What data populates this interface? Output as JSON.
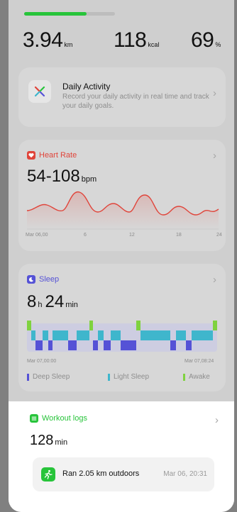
{
  "summary": {
    "distance": {
      "value": "3.94",
      "unit": "km"
    },
    "calories": {
      "value": "118",
      "unit": "kcal"
    },
    "goal": {
      "value": "69",
      "unit": "%"
    },
    "progress": 0.69
  },
  "daily_activity": {
    "title": "Daily Activity",
    "description": "Record your daily activity in real time and track your daily goals."
  },
  "heart_rate": {
    "title": "Heart Rate",
    "range": "54-108",
    "unit": "bpm",
    "x_labels": [
      "Mar 06,00",
      "6",
      "12",
      "18",
      "24"
    ],
    "color": "#e0443a"
  },
  "sleep": {
    "title": "Sleep",
    "hours": "8",
    "hours_unit": "h",
    "minutes": "24",
    "minutes_unit": "min",
    "start_label": "Mar 07,00:00",
    "end_label": "Mar 07,08:24",
    "legend": [
      {
        "label": "Deep Sleep",
        "color": "#5552d6"
      },
      {
        "label": "Light Sleep",
        "color": "#3fb6cc"
      },
      {
        "label": "Awake",
        "color": "#7fd23f"
      }
    ]
  },
  "workout": {
    "title": "Workout logs",
    "duration": "128",
    "unit": "min",
    "entry": {
      "text": "Ran 2.05 km outdoors",
      "time": "Mar 06, 20:31"
    },
    "color": "#27c43a"
  },
  "icons": {
    "daily_activity": "activity-icon",
    "heart_rate": "heart-icon",
    "sleep": "moon-icon",
    "workout": "list-icon",
    "run": "running-icon",
    "chevron": "chevron-right-icon"
  }
}
